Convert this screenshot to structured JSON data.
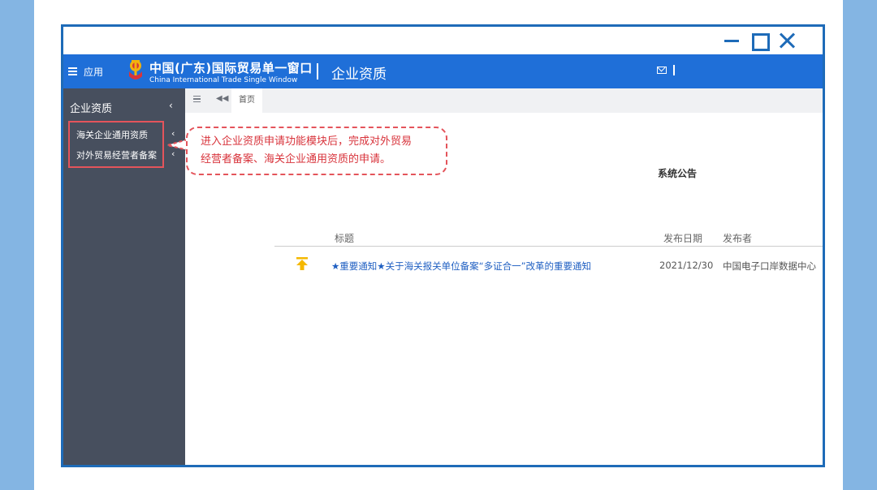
{
  "app_bar": {
    "menu_label": "应用",
    "brand_cn": "中国(广东)国际贸易单一窗口",
    "brand_en": "China International Trade Single Window",
    "module_title": "企业资质",
    "icons": [
      "menu-icon",
      "mail-icon"
    ]
  },
  "window_controls": [
    "minimize",
    "maximize",
    "close"
  ],
  "sidebar": {
    "header": "企业资质",
    "items": [
      {
        "label": "海关企业通用资质"
      },
      {
        "label": "对外贸易经营者备案"
      }
    ]
  },
  "tabs": {
    "home": "首页"
  },
  "callout": {
    "line1": "进入企业资质申请功能模块后，完成对外贸易",
    "line2": "经营者备案、海关企业通用资质的申请。"
  },
  "notice": {
    "title": "系统公告",
    "columns": {
      "title": "标题",
      "date": "发布日期",
      "publisher": "发布者"
    },
    "rows": [
      {
        "title": "★重要通知★关于海关报关单位备案“多证合一”改革的重要通知",
        "date": "2021/12/30",
        "publisher": "中国电子口岸数据中心"
      }
    ]
  },
  "colors": {
    "app_bar": "#1f6fd8",
    "sidebar": "#474f5e",
    "window_border": "#1e6bb8",
    "highlight": "#e4545b",
    "side_bands": "#84b5e3"
  }
}
